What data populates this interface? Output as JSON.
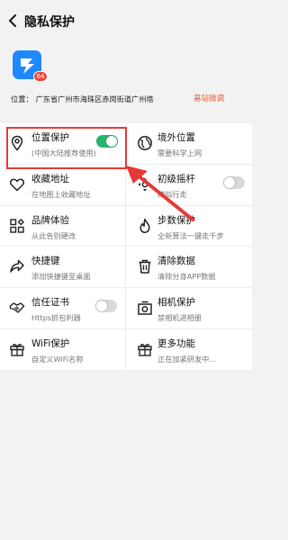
{
  "header": {
    "title": "隐私保护"
  },
  "app": {
    "badge": "64"
  },
  "location": {
    "label": "位置：",
    "value": "广东省广州市海珠区赤岗街道广州塔",
    "fine_tune": "基站微调"
  },
  "colors": {
    "accent_red": "#e53935",
    "toggle_on": "#27b66b",
    "link_orange": "#e55b2f"
  },
  "features": [
    {
      "id": "location-protect",
      "icon": "location-pin-icon",
      "label": "位置保护",
      "sub": "(中国大陆推荐使用)",
      "toggle": true
    },
    {
      "id": "overseas-location",
      "icon": "globe-icon",
      "label": "境外位置",
      "sub": "需要科学上网"
    },
    {
      "id": "favorite-address",
      "icon": "heart-icon",
      "label": "收藏地址",
      "sub": "在地图上收藏地址"
    },
    {
      "id": "joystick",
      "icon": "joystick-icon",
      "label": "初级摇杆",
      "sub": "模拟行走",
      "toggle": false
    },
    {
      "id": "brand-experience",
      "icon": "blocks-icon",
      "label": "品牌体验",
      "sub": "从此告别硬改"
    },
    {
      "id": "step-protect",
      "icon": "flame-icon",
      "label": "步数保护",
      "sub": "全新算法一键走千步"
    },
    {
      "id": "shortcut",
      "icon": "share-arrow-icon",
      "label": "快捷键",
      "sub": "添加快捷键至桌面"
    },
    {
      "id": "clear-data",
      "icon": "trash-icon",
      "label": "清除数据",
      "sub": "清除分身APP数据"
    },
    {
      "id": "trust-cert",
      "icon": "handshake-icon",
      "label": "信任证书",
      "sub": "Https抓包利器",
      "toggle": false
    },
    {
      "id": "camera-protect",
      "icon": "camera-icon",
      "label": "相机保护",
      "sub": "禁相机进相册"
    },
    {
      "id": "wifi-protect",
      "icon": "gift-icon",
      "label": "WiFi保护",
      "sub": "自定义WiFi名称"
    },
    {
      "id": "more-features",
      "icon": "gift-icon",
      "label": "更多功能",
      "sub": "正在加紧研发中..."
    }
  ]
}
